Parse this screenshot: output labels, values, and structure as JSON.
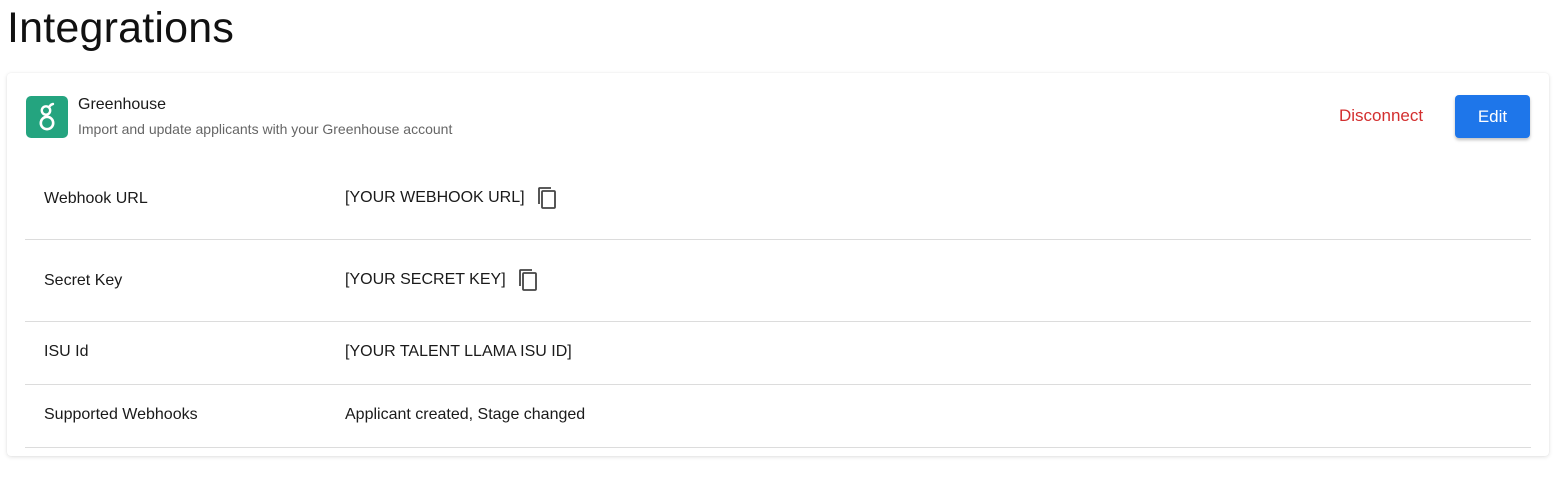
{
  "page": {
    "title": "Integrations"
  },
  "integration": {
    "name": "Greenhouse",
    "description": "Import and update applicants with your Greenhouse account",
    "logo_letter": "g",
    "logo_color": "#24a47f",
    "disconnect_label": "Disconnect",
    "edit_label": "Edit"
  },
  "fields": [
    {
      "label": "Webhook URL",
      "value": "[YOUR WEBHOOK URL]",
      "copyable": true,
      "icon": "copy-icon"
    },
    {
      "label": "Secret Key",
      "value": "[YOUR SECRET KEY]",
      "copyable": true,
      "icon": "copy-icon"
    },
    {
      "label": "ISU Id",
      "value": "[YOUR TALENT LLAMA ISU ID]",
      "copyable": false
    },
    {
      "label": "Supported Webhooks",
      "value": "Applicant created, Stage changed",
      "copyable": false
    }
  ],
  "colors": {
    "accent": "#1e76ea",
    "danger": "#d32f2f",
    "brand": "#24a47f"
  }
}
